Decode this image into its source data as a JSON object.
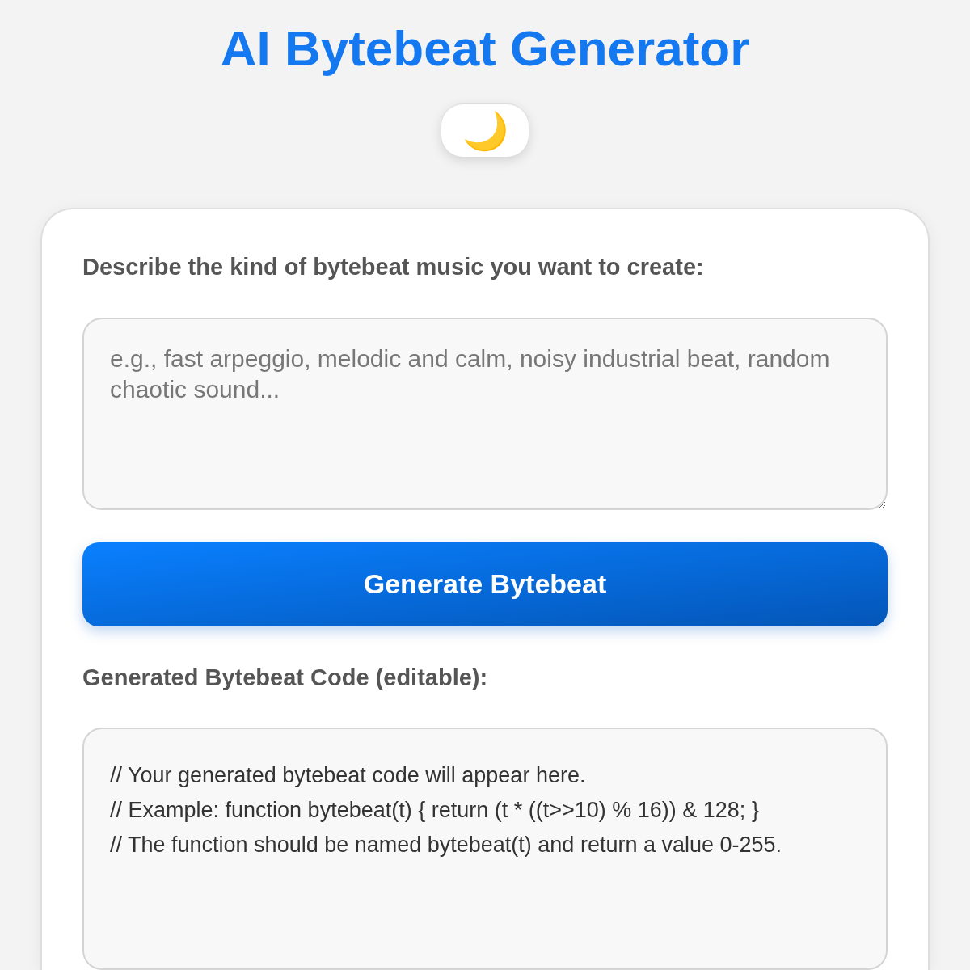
{
  "title": "AI Bytebeat Generator",
  "theme_toggle": {
    "icon": "🌙"
  },
  "prompt": {
    "label": "Describe the kind of bytebeat music you want to create:",
    "placeholder": "e.g., fast arpeggio, melodic and calm, noisy industrial beat, random chaotic sound..."
  },
  "generate_button": "Generate Bytebeat",
  "code": {
    "label": "Generated Bytebeat Code (editable):",
    "value": "// Your generated bytebeat code will appear here.\n// Example: function bytebeat(t) { return (t * ((t>>10) % 16)) & 128; }\n// The function should be named bytebeat(t) and return a value 0-255."
  }
}
